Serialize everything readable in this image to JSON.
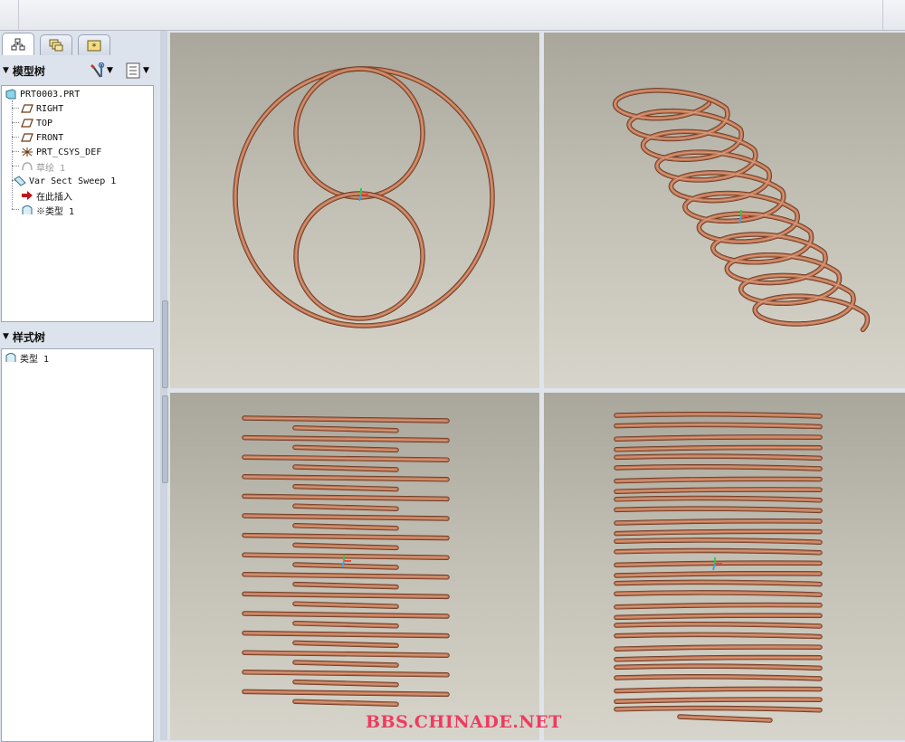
{
  "tabs": [
    {
      "name": "model-tree-tab-icon"
    },
    {
      "name": "layers-tab-icon"
    },
    {
      "name": "favorites-tab-icon"
    }
  ],
  "model_tree": {
    "title": "模型树",
    "items": [
      {
        "label": "PRT0003.PRT",
        "icon": "part-icon",
        "dim": false
      },
      {
        "label": "RIGHT",
        "icon": "datum-plane-icon",
        "dim": false
      },
      {
        "label": "TOP",
        "icon": "datum-plane-icon",
        "dim": false
      },
      {
        "label": "FRONT",
        "icon": "datum-plane-icon",
        "dim": false
      },
      {
        "label": "PRT_CSYS_DEF",
        "icon": "csys-icon",
        "dim": false
      },
      {
        "label": "草绘 1",
        "icon": "sketch-icon",
        "dim": true
      },
      {
        "label": "Var Sect Sweep 1",
        "icon": "sweep-icon",
        "dim": false
      },
      {
        "label": "在此插入",
        "icon": "insert-here-arrow-icon",
        "dim": false
      },
      {
        "label": "※类型 1",
        "icon": "style-icon",
        "dim": false
      }
    ]
  },
  "style_tree": {
    "title": "样式树",
    "items": [
      {
        "label": "类型 1",
        "icon": "style-icon"
      }
    ]
  },
  "watermark": "BBS.CHINADE.NET",
  "colors": {
    "wire": "#b7704f",
    "wire_highlight": "#e2a888",
    "wire_shadow": "#6e3a26",
    "watermark": "#ee3b5f"
  }
}
